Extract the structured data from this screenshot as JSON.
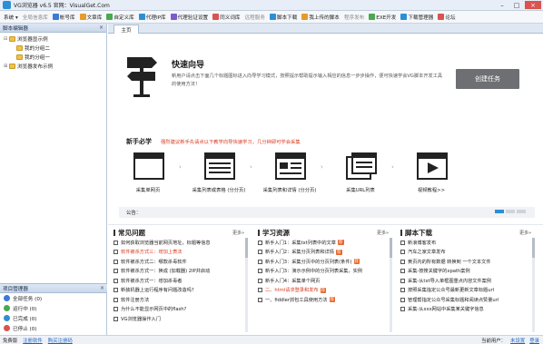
{
  "window": {
    "title": "VG浏览器 v6.5 官网：VisualGet.Com",
    "buttons": [
      "–",
      "□",
      "×"
    ]
  },
  "menubar": {
    "items": [
      {
        "label": "系统 ▾",
        "icon": "none",
        "color": "",
        "gray": false
      },
      {
        "label": "全局信息库",
        "icon": "none",
        "color": "",
        "gray": true
      },
      {
        "label": "帐号库",
        "icon": "account-icon",
        "color": "#3a7bd5",
        "gray": false
      },
      {
        "label": "文章库",
        "icon": "article-icon",
        "color": "#e89a2a",
        "gray": false
      },
      {
        "label": "自定义库",
        "icon": "custom-icon",
        "color": "#4aa84f",
        "gray": false
      },
      {
        "label": "代理IP库",
        "icon": "proxy-icon",
        "color": "#2c8fd6",
        "gray": false
      },
      {
        "label": "代理验证设置",
        "icon": "verify-icon",
        "color": "#7a5ccf",
        "gray": false
      },
      {
        "label": "同义词库",
        "icon": "synonym-icon",
        "color": "#d9534f",
        "gray": false
      },
      {
        "label": "远程服务",
        "icon": "none",
        "color": "",
        "gray": true
      },
      {
        "label": "脚本下载",
        "icon": "download-icon",
        "color": "#2c8fd6",
        "gray": false
      },
      {
        "label": "我上传的脚本",
        "icon": "upload-icon",
        "color": "#e89a2a",
        "gray": false
      },
      {
        "label": "程序发布",
        "icon": "none",
        "color": "",
        "gray": true
      },
      {
        "label": "EXE开发",
        "icon": "exe-icon",
        "color": "#4aa84f",
        "gray": false
      },
      {
        "label": "下载管理器",
        "icon": "download-manager-icon",
        "color": "#2c8fd6",
        "gray": false
      },
      {
        "label": "论坛",
        "icon": "forum-icon",
        "color": "#d9534f",
        "gray": false
      }
    ]
  },
  "scripts_panel": {
    "title": "脚本编辑器",
    "close": "×",
    "tree": [
      {
        "label": "浏览器显示例",
        "level": 0,
        "toggle": "⊟"
      },
      {
        "label": "我的分组二",
        "level": 1,
        "toggle": ""
      },
      {
        "label": "我的分组一",
        "level": 1,
        "toggle": ""
      },
      {
        "label": "浏览器发布示例",
        "level": 0,
        "toggle": "⊞"
      }
    ]
  },
  "task_panel": {
    "title": "项目管理器",
    "close": "×",
    "items": [
      {
        "label": "全部任务 (0)",
        "color": "#3a7bd5"
      },
      {
        "label": "运行中 (0)",
        "color": "#4aa84f"
      },
      {
        "label": "已完成 (0)",
        "color": "#2c8fd6"
      },
      {
        "label": "已停止 (0)",
        "color": "#d9534f"
      },
      {
        "label": "计划任务 (0)",
        "color": "#e89a2a"
      }
    ]
  },
  "main": {
    "tab": "主页",
    "quick_guide": {
      "title": "快速向导",
      "description": "新用户请点击下面几个标题图标进入向导学习模式，按照提示帮助提示输入相应的信息一步步操作，便可快速学会VG脚本开发工具的使用方法！",
      "create_button": "创建任务"
    },
    "newbie": {
      "title": "新手必学",
      "tip": "强烈建议新手先请点以下教学向导快速学习，几分钟即可学会采集",
      "steps": [
        {
          "label": "采集单网页",
          "icon": "single-page-icon"
        },
        {
          "label": "采集列表或表格 (分分页)",
          "icon": "list-table-icon"
        },
        {
          "label": "采集列表和详情 (分分页)",
          "icon": "list-detail-icon"
        },
        {
          "label": "采集URL列表",
          "icon": "url-list-icon"
        },
        {
          "label": "视频教程>>",
          "icon": "video-icon"
        }
      ],
      "notice_label": "公告：",
      "arrow": "›"
    },
    "columns": [
      {
        "title": "常见问题",
        "icon": "question-icon",
        "more": "更多»",
        "items": [
          {
            "text": "如何获取浏览器当前网页地址，标题等信息",
            "red": false,
            "hot": false
          },
          {
            "text": "软件被杀方式三：增加上表法",
            "red": true,
            "hot": false
          },
          {
            "text": "软件被杀方式二：哪款杀毒软件",
            "red": false,
            "hot": false
          },
          {
            "text": "软件被杀方式一：换成 (加载器) 2IP并启动",
            "red": false,
            "hot": false
          },
          {
            "text": "软件被杀方式一：增加杀毒者",
            "red": false,
            "hot": false
          },
          {
            "text": "新装机器上运行程序有问题改造吗？",
            "red": false,
            "hot": false
          },
          {
            "text": "软件注册方法",
            "red": false,
            "hot": false
          },
          {
            "text": "为什么不能显示网页中的flash?",
            "red": false,
            "hot": false
          },
          {
            "text": "VG浏览器操作入门",
            "red": false,
            "hot": false
          }
        ]
      },
      {
        "title": "学习资源",
        "icon": "learning-icon",
        "more": "更多»",
        "items": [
          {
            "text": "新手入门1：采集txt列表中的文章",
            "red": false,
            "hot": true
          },
          {
            "text": "新手入门2：采集分页列表和详情",
            "red": false,
            "hot": true
          },
          {
            "text": "新手入门3：采集分页中的分页列表(条件)",
            "red": false,
            "hot": true
          },
          {
            "text": "新手入门3：演示示例中的分页列表采集，实例",
            "red": false,
            "hot": false
          },
          {
            "text": "新手入门4：采集单个网页",
            "red": false,
            "hot": false
          },
          {
            "text": "二、html请求登录和发布",
            "red": true,
            "hot": true
          },
          {
            "text": "一、fiddler抓包工具使用方法",
            "red": false,
            "hot": true
          }
        ]
      },
      {
        "title": "脚本下载",
        "icon": "script-download-icon",
        "more": "更多»",
        "items": [
          {
            "text": "新浪博客发布",
            "red": false,
            "hot": false
          },
          {
            "text": "汽车之家文章发布",
            "red": false,
            "hot": false
          },
          {
            "text": "黄页内的所有数据 转换到 一个文本文件",
            "red": false,
            "hot": false
          },
          {
            "text": "采集-按搜关键字的xpath案例",
            "red": false,
            "hot": false
          },
          {
            "text": "采集-从txt导入单框图重点内容文件案例",
            "red": false,
            "hot": false
          },
          {
            "text": "按照采集指定公众号最新更新文章标题url",
            "red": false,
            "hot": false
          },
          {
            "text": "管理帮指定公众号采集标题和阅读点赞量url",
            "red": false,
            "hot": false
          },
          {
            "text": "采集-从xxx网站中采集某关键字信息",
            "red": false,
            "hot": false
          }
        ]
      }
    ]
  },
  "statusbar": {
    "left": "免费版",
    "links": [
      "注册软件",
      "购买注册码"
    ],
    "right_label": "当前用户：",
    "right_links": [
      "未设置",
      "登录"
    ]
  }
}
